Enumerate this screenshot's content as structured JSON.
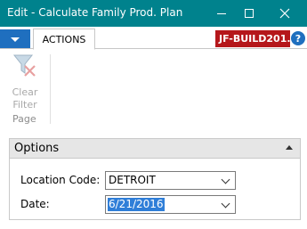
{
  "window": {
    "title": "Edit - Calculate Family Prod. Plan",
    "controls": [
      "minimize-icon",
      "maximize-icon",
      "close-icon"
    ]
  },
  "ribbon": {
    "tabs": [
      {
        "label": "ACTIONS",
        "selected": true
      }
    ],
    "company": "JF-BUILD201...",
    "help": "?",
    "actions": [
      {
        "label_line1": "Clear",
        "label_line2": "Filter",
        "icon": "clear-filter-icon",
        "enabled": false
      }
    ],
    "group_label": "Page"
  },
  "options": {
    "title": "Options",
    "location_label": "Location Code:",
    "location_value": "DETROIT",
    "date_label": "Date:",
    "date_value": "6/21/2016"
  },
  "colors": {
    "titlebar": "#00828d",
    "app_button": "#1f6fbf",
    "company_badge": "#b5171b",
    "selection": "#2f7ed8"
  }
}
